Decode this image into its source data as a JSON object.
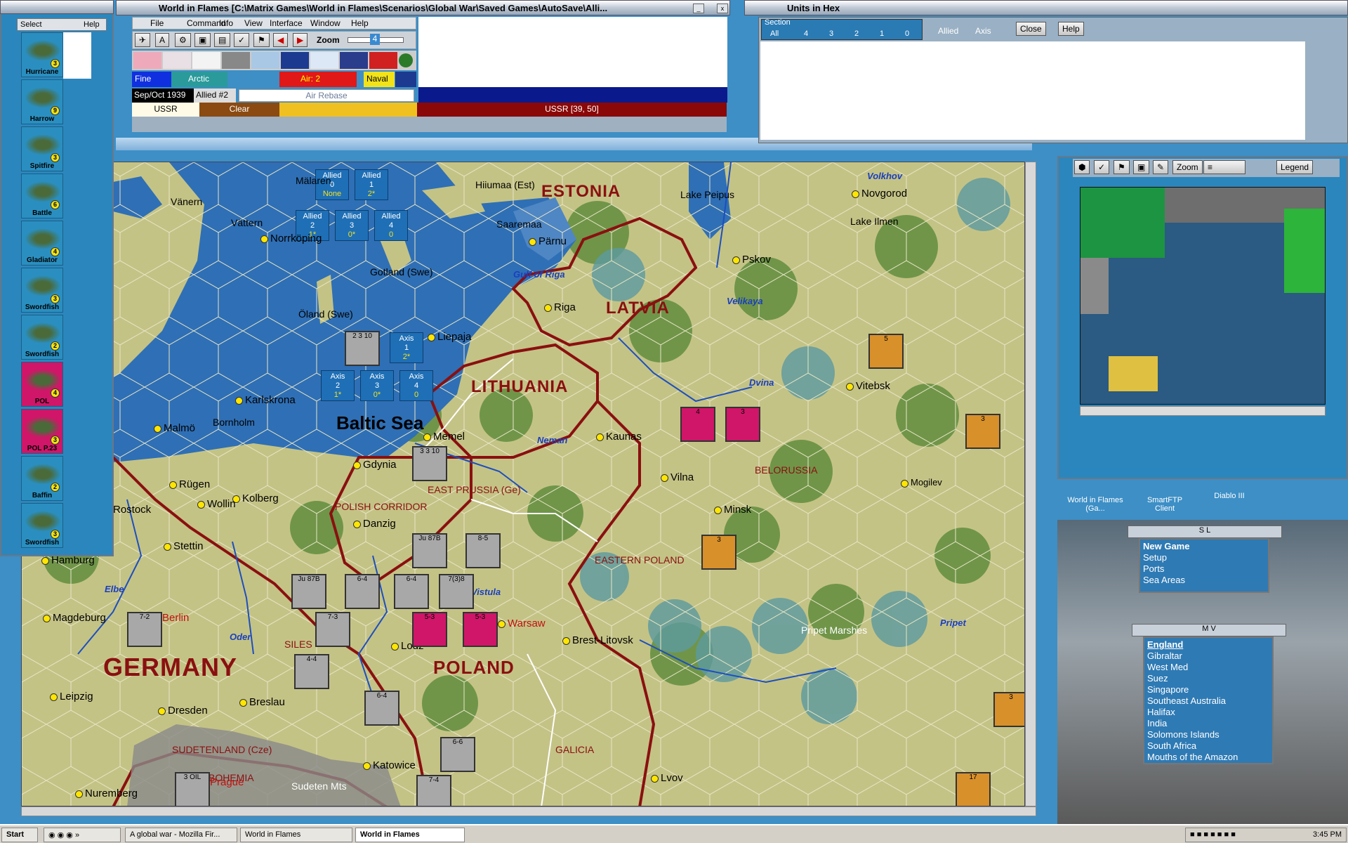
{
  "main_window": {
    "title": "World in Flames [C:\\Matrix Games\\World in Flames\\Scenarios\\Global War\\Saved Games\\AutoSave\\Alli...",
    "menu": [
      "File",
      "Command",
      "Info",
      "View",
      "Interface",
      "Window",
      "Help"
    ],
    "zoom_label": "Zoom",
    "zoom_value": "4"
  },
  "status": {
    "weather": "Fine",
    "zone": "Arctic",
    "air": "Air: 2",
    "naval": "Naval",
    "date": "Sep/Oct 1939",
    "impulse": "Allied #2",
    "action": "Air Rebase",
    "country": "USSR",
    "terrain": "Clear",
    "hex": "USSR [39, 50]"
  },
  "left_panel": {
    "tabs": [
      "Select",
      "Help"
    ],
    "units": [
      {
        "name": "Hurricane",
        "value": "3",
        "color": "#2a8fc0"
      },
      {
        "name": "Harrow",
        "value": "9",
        "color": "#2a8fc0"
      },
      {
        "name": "Spitfire",
        "value": "3",
        "color": "#2a8fc0"
      },
      {
        "name": "Battle",
        "value": "6",
        "color": "#2a8fc0"
      },
      {
        "name": "Gladiator",
        "value": "4",
        "color": "#2a8fc0"
      },
      {
        "name": "Swordfish",
        "value": "3",
        "color": "#2a8fc0"
      },
      {
        "name": "Swordfish",
        "value": "2",
        "color": "#2a8fc0"
      },
      {
        "name": "POL",
        "value": "4",
        "color": "#d01668"
      },
      {
        "name": "POL P.23",
        "value": "3",
        "color": "#d01668"
      },
      {
        "name": "Baffin",
        "value": "2",
        "color": "#2a8fc0"
      },
      {
        "name": "Swordfish",
        "value": "3",
        "color": "#2a8fc0"
      }
    ]
  },
  "units_in_hex": {
    "title": "Units in Hex",
    "section_label": "Section",
    "options": [
      "All",
      "4",
      "3",
      "2",
      "1",
      "0"
    ],
    "allied": "Allied",
    "axis": "Axis",
    "close": "Close",
    "help": "Help"
  },
  "minimap": {
    "zoom": "Zoom",
    "legend": "Legend"
  },
  "desktop_icons": [
    "World in Flames (Ga...",
    "SmartFTP Client",
    "Diablo III"
  ],
  "sl_menu": {
    "title": "S L",
    "items": [
      "New Game",
      "Setup",
      "Ports",
      "Sea Areas"
    ]
  },
  "mv_menu": {
    "title": "M V",
    "items": [
      "England",
      "Gibraltar",
      "West Med",
      "Suez",
      "Singapore",
      "Southeast Australia",
      "Halifax",
      "India",
      "Solomons Islands",
      "South Africa",
      "Mouths of the Amazon"
    ]
  },
  "map": {
    "sea": "Baltic Sea",
    "countries": [
      "ESTONIA",
      "LATVIA",
      "LITHUANIA",
      "GERMANY",
      "POLAND"
    ],
    "regions": [
      "EAST PRUSSIA (Ge)",
      "POLISH CORRIDOR",
      "BELORUSSIA",
      "EASTERN POLAND",
      "SUDETENLAND (Cze)",
      "GALICIA",
      "SILES",
      "BOHEMIA"
    ],
    "cities": [
      "Novgorod",
      "Pskov",
      "Riga",
      "Kaunas",
      "Vilna",
      "Minsk",
      "Vitebsk",
      "Mogilev",
      "Brest-Litovsk",
      "Lvov",
      "Memel",
      "Gdynia",
      "Danzig",
      "Stettin",
      "Kolberg",
      "Berlin",
      "Magdeburg",
      "Leipzig",
      "Dresden",
      "Breslau",
      "Katowice",
      "Prague",
      "Nuremberg",
      "Malmö",
      "Karlskrona",
      "Norrköping",
      "Pärnu",
      "Liepaja",
      "Warsaw",
      "Lodz",
      "Hamburg",
      "Rügen",
      "Wollin",
      "Rostock"
    ],
    "labels": [
      "Mälaren",
      "Vänern",
      "Vättern",
      "Gotland (Swe)",
      "Öland (Swe)",
      "Saaremaa",
      "Hiiumaa (Est)",
      "Lake Peipus",
      "Lake Ilmen",
      "Gulf of Riga",
      "Bornholm",
      "Pripet Marshes",
      "Sudeten Mts"
    ],
    "rivers": [
      "Volkhov",
      "Velikaya",
      "Dvina",
      "Neman",
      "Elbe",
      "Oder",
      "Vistula",
      "Pripet"
    ],
    "sea_boxes": [
      {
        "side": "Allied",
        "n": "0",
        "v": "None"
      },
      {
        "side": "Allied",
        "n": "1",
        "v": "2*"
      },
      {
        "side": "Allied",
        "n": "2",
        "v": "1*"
      },
      {
        "side": "Allied",
        "n": "3",
        "v": "0*"
      },
      {
        "side": "Allied",
        "n": "4",
        "v": "0"
      },
      {
        "side": "Axis",
        "n": "1",
        "v": "2*"
      },
      {
        "side": "Axis",
        "n": "2",
        "v": "1*"
      },
      {
        "side": "Axis",
        "n": "3",
        "v": "0*"
      },
      {
        "side": "Axis",
        "n": "4",
        "v": "0"
      }
    ]
  },
  "taskbar": {
    "start": "Start",
    "items": [
      "A global war - Mozilla Fir...",
      "World in Flames",
      "World in Flames"
    ],
    "clock": "3:45 PM"
  },
  "colors": {
    "sea": "#2f6fb5",
    "land": "#c9c98a",
    "forest": "#5f8a3a",
    "border": "#8a1010",
    "panel": "#2e7ab4"
  }
}
